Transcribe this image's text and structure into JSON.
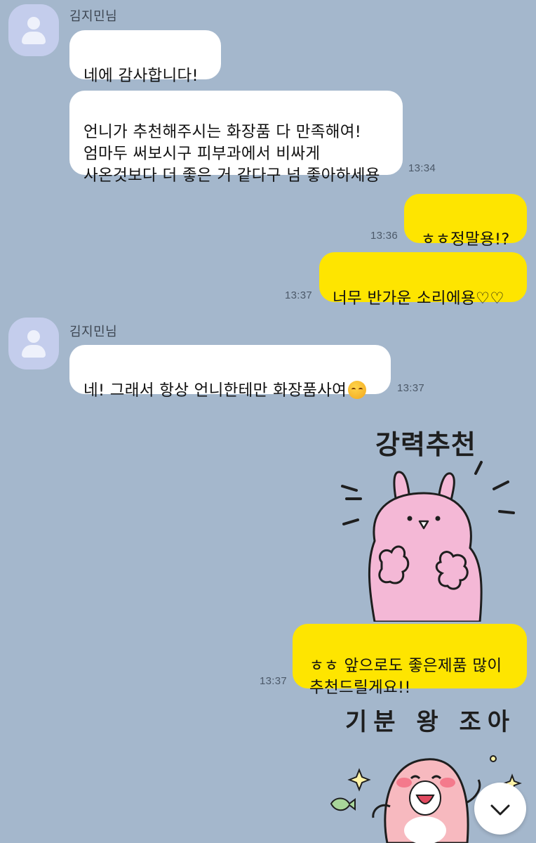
{
  "messages": {
    "m1": {
      "sender": "김지민님",
      "b1": "네에 감사합니다!",
      "b2": "언니가 추천해주시는 화장품 다 만족해여!\n엄마두 써보시구 피부과에서 비싸게\n사온것보다 더 좋은 거 같다구 넘 좋아하세용",
      "b2_time": "13:34"
    },
    "m2": {
      "text": "ㅎㅎ정말용!?",
      "time": "13:36"
    },
    "m3": {
      "text": "너무 반가운 소리에용♡♡",
      "time": "13:37"
    },
    "m4": {
      "sender": "김지민님",
      "text": "네! 그래서 항상 언니한테만 화장품사여",
      "time": "13:37"
    },
    "sticker1": {
      "caption": "강력추천"
    },
    "m5": {
      "text": "ㅎㅎ 앞으로도 좋은제품 많이\n추천드릴게요!!",
      "time": "13:37"
    },
    "sticker2": {
      "caption": "기분 왕 조아"
    }
  },
  "icons": {
    "avatar": "default-profile-icon",
    "emoji": "smiling-face-emoji",
    "scroll": "chevron-down-icon"
  },
  "colors": {
    "background": "#a4b7cc",
    "my_bubble": "#fee500",
    "their_bubble": "#ffffff",
    "avatar": "#c4cdec"
  }
}
